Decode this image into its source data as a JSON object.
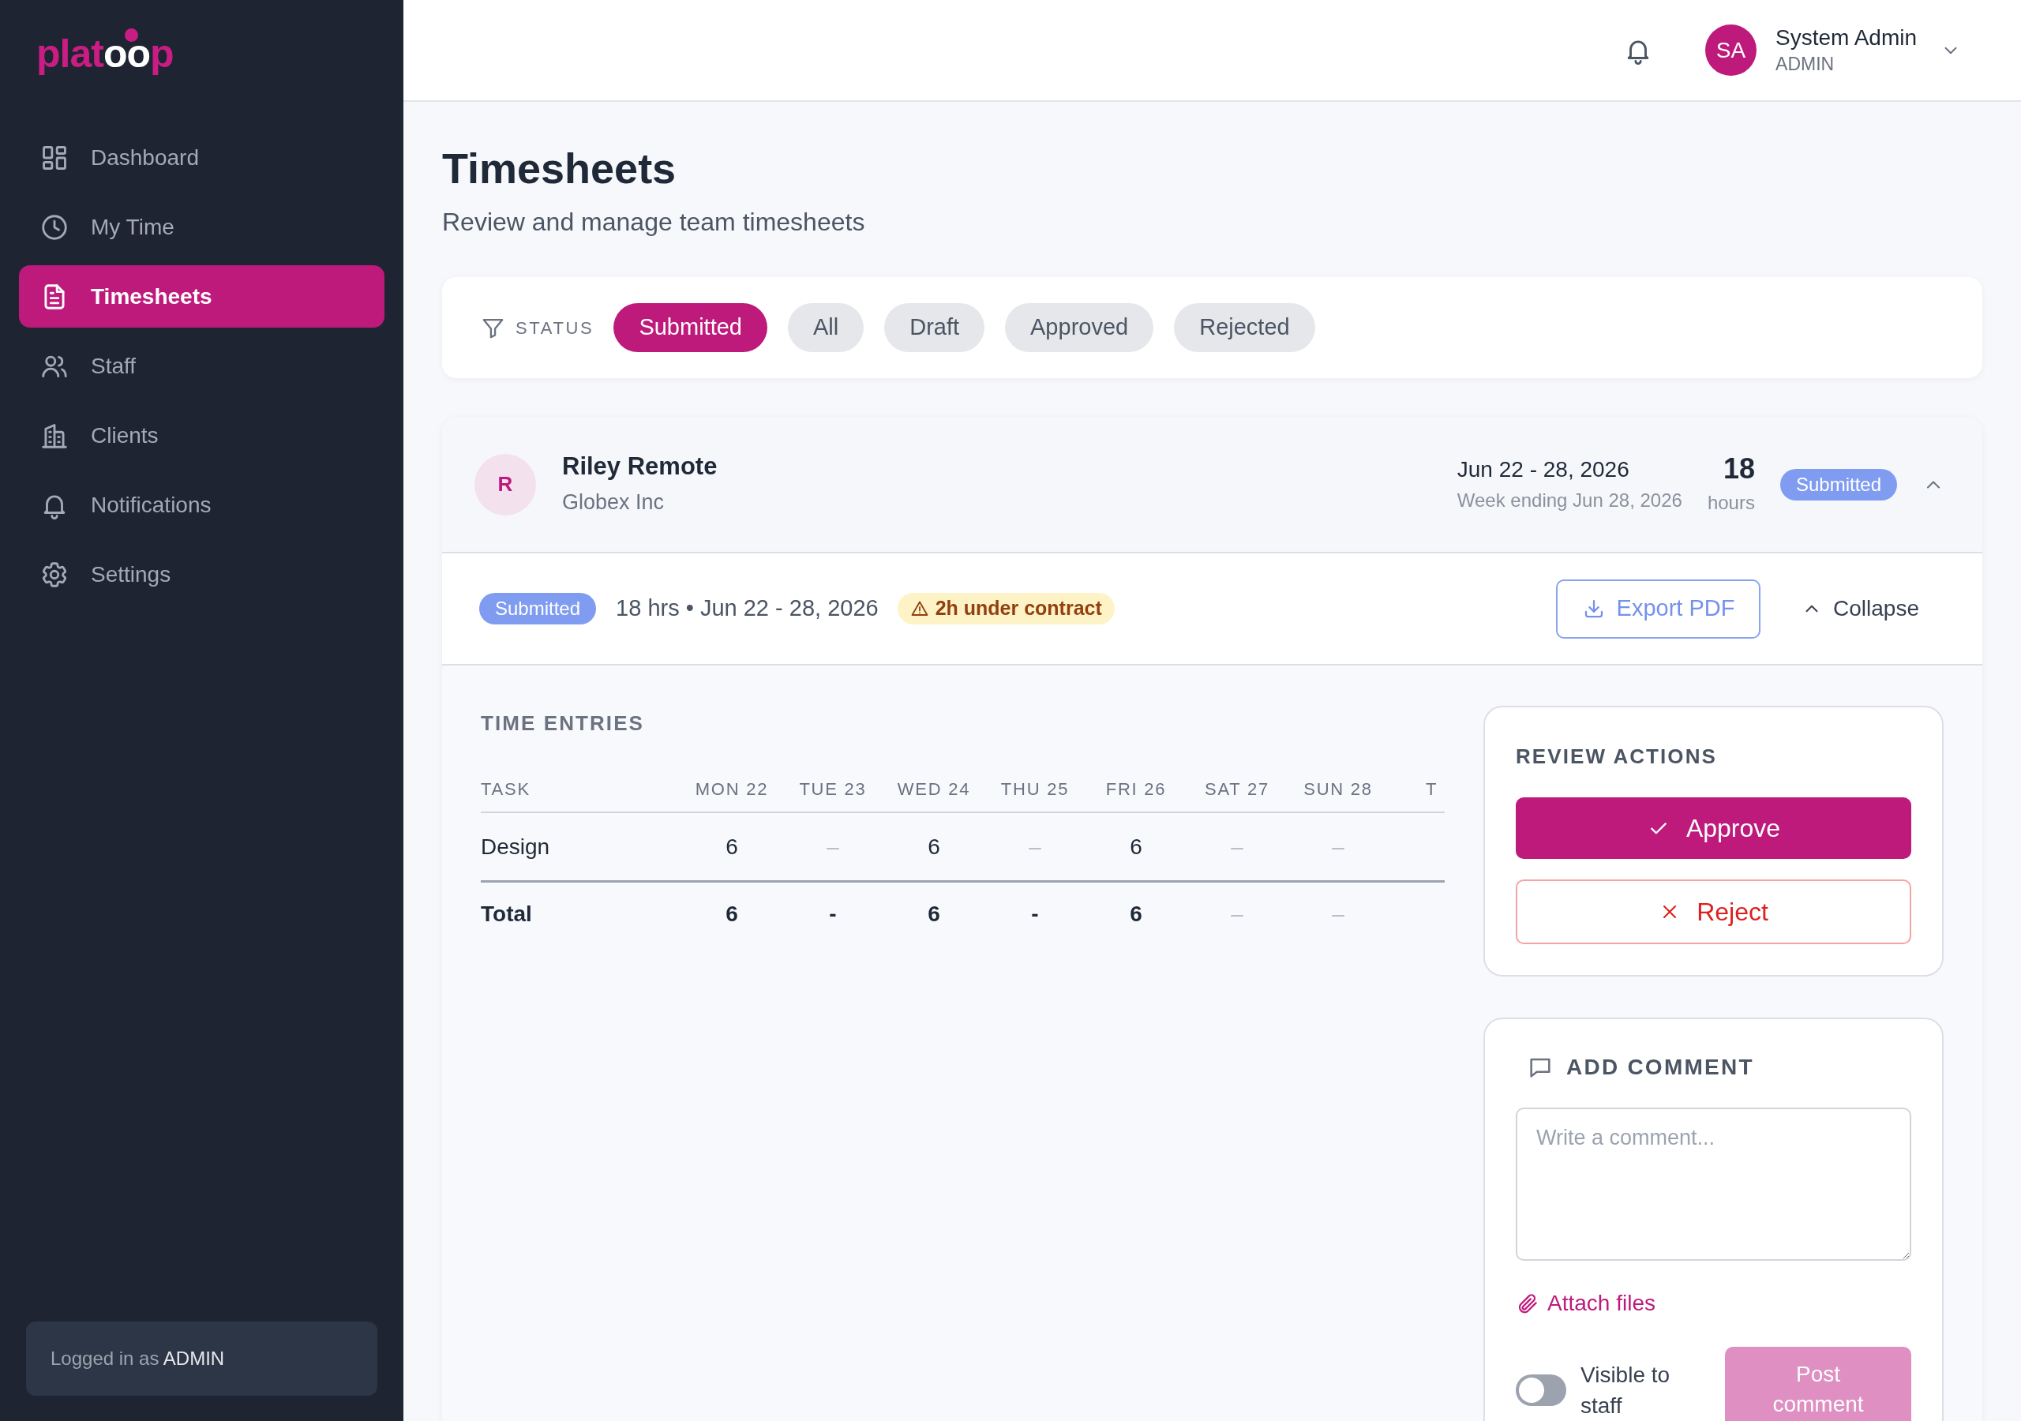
{
  "sidebar": {
    "logo": {
      "lead": "plat",
      "mark": "oo",
      "tail": "p"
    },
    "items": [
      {
        "label": "Dashboard",
        "selected": false
      },
      {
        "label": "My Time",
        "selected": false
      },
      {
        "label": "Timesheets",
        "selected": true
      },
      {
        "label": "Staff",
        "selected": false
      },
      {
        "label": "Clients",
        "selected": false
      },
      {
        "label": "Notifications",
        "selected": false
      },
      {
        "label": "Settings",
        "selected": false
      }
    ],
    "footer": {
      "prefix": "Logged in as",
      "role": "ADMIN"
    }
  },
  "header": {
    "user": {
      "initials": "SA",
      "name": "System Admin",
      "role": "ADMIN"
    }
  },
  "page": {
    "title": "Timesheets",
    "subtitle": "Review and manage team timesheets"
  },
  "filter": {
    "label": "STATUS",
    "chips": [
      {
        "label": "Submitted",
        "selected": true
      },
      {
        "label": "All",
        "selected": false
      },
      {
        "label": "Draft",
        "selected": false
      },
      {
        "label": "Approved",
        "selected": false
      },
      {
        "label": "Rejected",
        "selected": false
      }
    ]
  },
  "timesheet": {
    "initial": "R",
    "name": "Riley Remote",
    "client": "Globex Inc",
    "range": "Jun 22 - 28, 2026",
    "week_ending": "Week ending Jun 28, 2026",
    "hours": "18",
    "hours_unit": "hours",
    "status": "Submitted",
    "expanded": true,
    "summary": {
      "status": "Submitted",
      "text": "18 hrs • Jun 22 - 28, 2026",
      "warning": "2h under contract"
    },
    "export_label": "Export PDF",
    "collapse_label": "Collapse",
    "entries": {
      "title": "TIME ENTRIES",
      "columns": [
        "TASK",
        "MON 22",
        "TUE 23",
        "WED 24",
        "THU 25",
        "FRI 26",
        "SAT 27",
        "SUN 28",
        "T"
      ],
      "rows": [
        {
          "kind": "task",
          "cells": [
            {
              "text": "Design",
              "muted": false
            },
            {
              "text": "6",
              "muted": false
            },
            {
              "text": "–",
              "muted": true
            },
            {
              "text": "6",
              "muted": false
            },
            {
              "text": "–",
              "muted": true
            },
            {
              "text": "6",
              "muted": false
            },
            {
              "text": "–",
              "muted": true
            },
            {
              "text": "–",
              "muted": true
            }
          ]
        },
        {
          "kind": "total",
          "cells": [
            {
              "text": "Total",
              "muted": false
            },
            {
              "text": "6",
              "muted": false
            },
            {
              "text": "-",
              "muted": false
            },
            {
              "text": "6",
              "muted": false
            },
            {
              "text": "-",
              "muted": false
            },
            {
              "text": "6",
              "muted": false
            },
            {
              "text": "–",
              "muted": true
            },
            {
              "text": "–",
              "muted": true
            }
          ]
        }
      ]
    },
    "review": {
      "title": "REVIEW ACTIONS",
      "buttons": [
        {
          "kind": "approve",
          "label": "Approve"
        },
        {
          "kind": "reject",
          "label": "Reject"
        }
      ]
    },
    "comment": {
      "title": "ADD COMMENT",
      "placeholder": "Write a comment...",
      "attach_label": "Attach files",
      "visible_label": "Visible to staff",
      "visible": false,
      "post_label": "Post comment",
      "post_disabled": true
    }
  }
}
